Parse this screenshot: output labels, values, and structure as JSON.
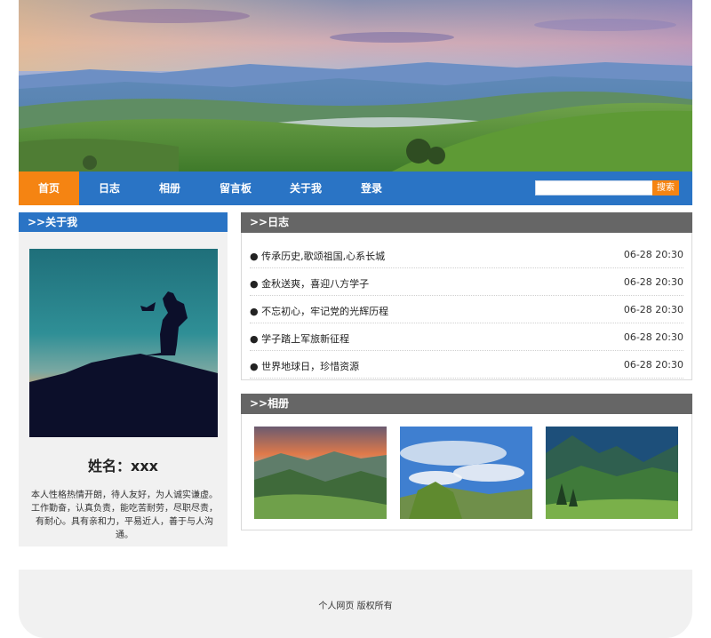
{
  "nav": {
    "items": [
      {
        "label": "首页",
        "active": true
      },
      {
        "label": "日志",
        "active": false
      },
      {
        "label": "相册",
        "active": false
      },
      {
        "label": "留言板",
        "active": false
      },
      {
        "label": "关于我",
        "active": false
      },
      {
        "label": "登录",
        "active": false
      }
    ],
    "search": {
      "value": "",
      "button_label": "搜索"
    }
  },
  "about": {
    "heading": ">>关于我",
    "name": "姓名：xxx",
    "bio": "本人性格热情开朗，待人友好，为人诚实谦虚。工作勤奋，认真负责，能吃苦耐劳，尽职尽责，有耐心。具有亲和力，平易近人，善于与人沟通。"
  },
  "diary": {
    "heading": ">>日志",
    "entries": [
      {
        "title": "● 传承历史,歌颂祖国,心系长城",
        "date": "06-28 20:30"
      },
      {
        "title": "● 金秋送爽，喜迎八方学子",
        "date": "06-28 20:30"
      },
      {
        "title": "● 不忘初心，牢记党的光辉历程",
        "date": "06-28 20:30"
      },
      {
        "title": "● 学子踏上军旅新征程",
        "date": "06-28 20:30"
      },
      {
        "title": "● 世界地球日，珍惜资源",
        "date": "06-28 20:30"
      }
    ]
  },
  "album": {
    "heading": ">>相册"
  },
  "footer": {
    "text": "个人网页 版权所有"
  },
  "colors": {
    "nav_bg": "#2a74c5",
    "accent": "#f58412",
    "panel_head": "#666666"
  }
}
